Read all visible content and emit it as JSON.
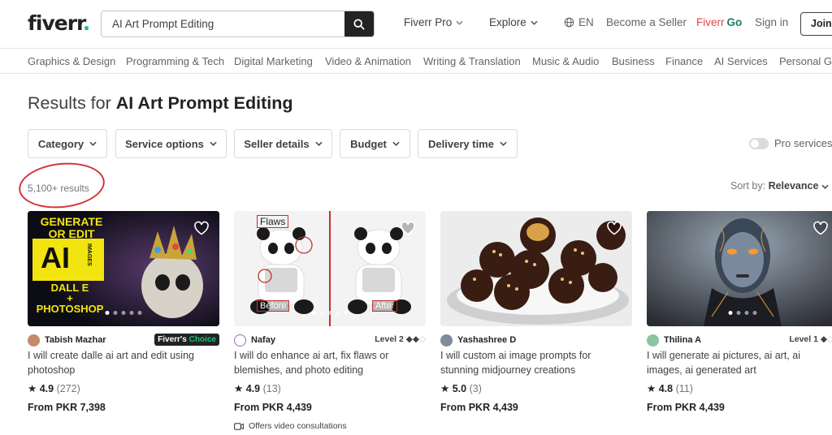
{
  "header": {
    "logo_text": "fiverr",
    "logo_dot": ".",
    "search_value": "AI Art Prompt Editing",
    "fiverr_pro": "Fiverr Pro",
    "explore": "Explore",
    "language": "EN",
    "become_seller": "Become a Seller",
    "fiverr_go_a": "Fiverr",
    "fiverr_go_b": "Go",
    "sign_in": "Sign in",
    "join": "Join"
  },
  "categories": [
    "Graphics & Design",
    "Programming & Tech",
    "Digital Marketing",
    "Video & Animation",
    "Writing & Translation",
    "Music & Audio",
    "Business",
    "Finance",
    "AI Services",
    "Personal Gro"
  ],
  "results": {
    "prefix": "Results for",
    "query": "AI Art Prompt Editing",
    "count": "5,100+ results",
    "sort_label": "Sort by:",
    "sort_value": "Relevance"
  },
  "filters": [
    "Category",
    "Service options",
    "Seller details",
    "Budget",
    "Delivery time"
  ],
  "pro_services": "Pro services",
  "gigs": [
    {
      "seller": "Tabish Mazhar",
      "badge_a": "Fiverr's",
      "badge_b": "Choice",
      "title": "I will create dalle ai art and edit using photoshop",
      "rating": "4.9",
      "reviews": "(272)",
      "price": "From PKR 7,398",
      "thumb_text": {
        "l1": "GENERATE",
        "l2": "OR EDIT",
        "ai": "AI",
        "images": "IMAGES",
        "l3": "DALL E",
        "plus": "+",
        "l4": "PHOTOSHOP"
      }
    },
    {
      "seller": "Nafay",
      "level": "Level 2",
      "title": "I will do enhance ai art, fix flaws or blemishes, and photo editing",
      "rating": "4.9",
      "reviews": "(13)",
      "price": "From PKR 4,439",
      "video": "Offers video consultations",
      "thumb_text": {
        "flaws": "Flaws",
        "before": "Before",
        "after": "After"
      }
    },
    {
      "seller": "Yashashree D",
      "title": "I will custom ai image prompts for stunning midjourney creations",
      "rating": "5.0",
      "reviews": "(3)",
      "price": "From PKR 4,439"
    },
    {
      "seller": "Thilina A",
      "level": "Level 1",
      "title": "I will generate ai pictures, ai art, ai images, ai generated art",
      "rating": "4.8",
      "reviews": "(11)",
      "price": "From PKR 4,439"
    }
  ],
  "colors": {
    "brand_green": "#1dbf73",
    "annotation_red": "#d3363c",
    "text_dark": "#222325"
  }
}
